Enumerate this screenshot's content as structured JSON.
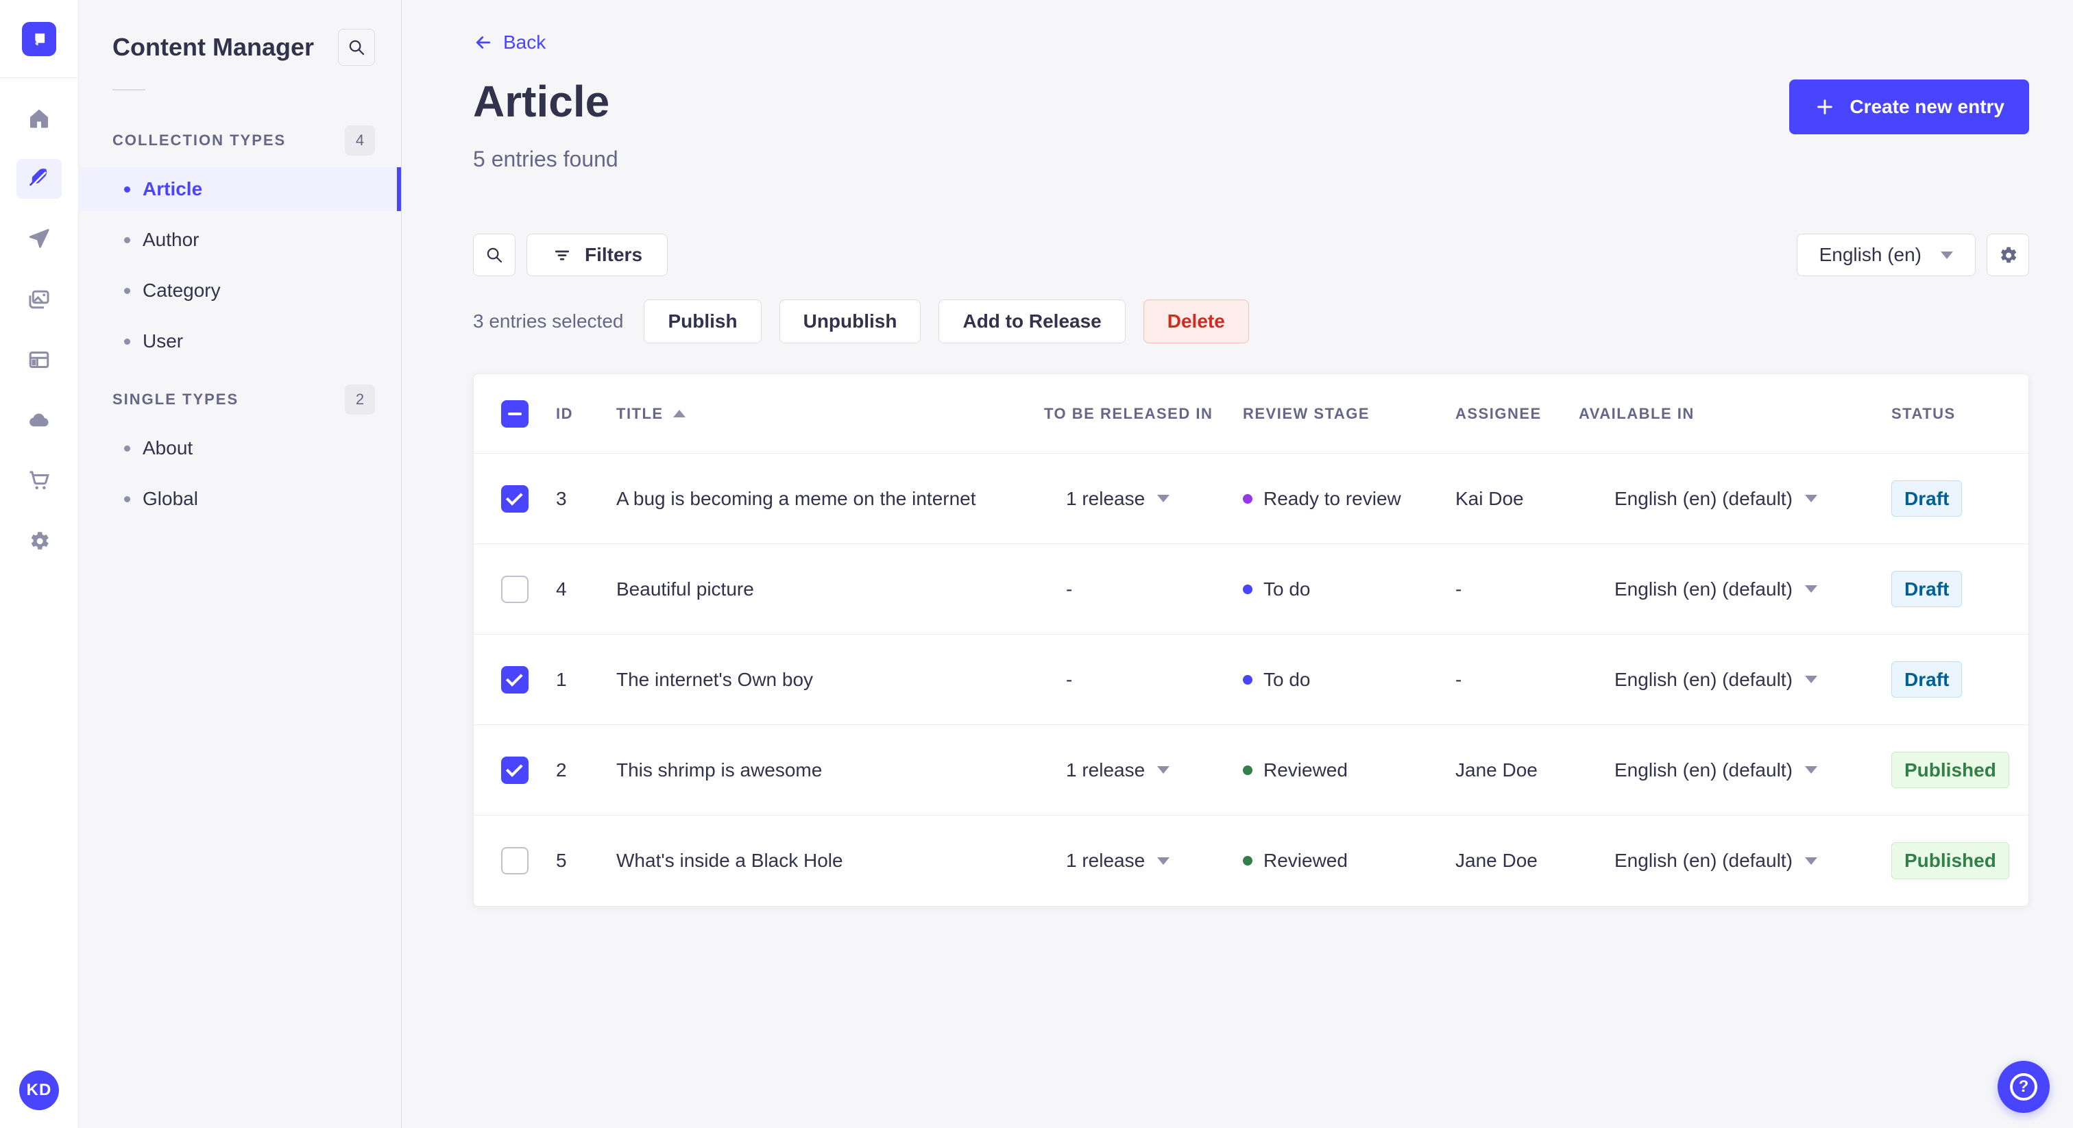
{
  "rail": {
    "icons": [
      "home",
      "content-manager",
      "releases",
      "media-library",
      "content-type-builder",
      "deploy-cloud",
      "marketplace",
      "settings"
    ],
    "active_icon": "content-manager",
    "avatar_initials": "KD"
  },
  "sidebar": {
    "title": "Content Manager",
    "sections": [
      {
        "label": "COLLECTION TYPES",
        "count": "4",
        "items": [
          {
            "label": "Article",
            "active": true
          },
          {
            "label": "Author"
          },
          {
            "label": "Category"
          },
          {
            "label": "User"
          }
        ]
      },
      {
        "label": "SINGLE TYPES",
        "count": "2",
        "items": [
          {
            "label": "About"
          },
          {
            "label": "Global"
          }
        ]
      }
    ]
  },
  "header": {
    "back": "Back",
    "title": "Article",
    "subtitle": "5 entries found",
    "create_button": "Create new entry"
  },
  "toolbar": {
    "filters": "Filters",
    "locale": "English (en)"
  },
  "selection": {
    "label": "3 entries selected",
    "publish": "Publish",
    "unpublish": "Unpublish",
    "add_to_release": "Add to Release",
    "delete": "Delete"
  },
  "table": {
    "columns": [
      "ID",
      "TITLE",
      "TO BE RELEASED IN",
      "REVIEW STAGE",
      "ASSIGNEE",
      "AVAILABLE IN",
      "STATUS"
    ],
    "sort": {
      "column": "TITLE",
      "direction": "ascending"
    },
    "header_checkbox": "indeterminate",
    "rows": [
      {
        "selected": true,
        "id": "3",
        "title": "A bug is becoming a meme on the internet",
        "release": "1 release",
        "release_dropdown": true,
        "stage": "Ready to review",
        "stage_color": "#9736E8",
        "assignee": "Kai Doe",
        "locale": "English (en) (default)",
        "status": "Draft",
        "status_kind": "draft"
      },
      {
        "selected": false,
        "id": "4",
        "title": "Beautiful picture",
        "release": "-",
        "release_dropdown": false,
        "stage": "To do",
        "stage_color": "#4945FF",
        "assignee": "-",
        "locale": "English (en) (default)",
        "status": "Draft",
        "status_kind": "draft"
      },
      {
        "selected": true,
        "id": "1",
        "title": "The internet's Own boy",
        "release": "-",
        "release_dropdown": false,
        "stage": "To do",
        "stage_color": "#4945FF",
        "assignee": "-",
        "locale": "English (en) (default)",
        "status": "Draft",
        "status_kind": "draft"
      },
      {
        "selected": true,
        "id": "2",
        "title": "This shrimp is awesome",
        "release": "1 release",
        "release_dropdown": true,
        "stage": "Reviewed",
        "stage_color": "#328048",
        "assignee": "Jane Doe",
        "locale": "English (en) (default)",
        "status": "Published",
        "status_kind": "published"
      },
      {
        "selected": false,
        "id": "5",
        "title": "What's inside a Black Hole",
        "release": "1 release",
        "release_dropdown": true,
        "stage": "Reviewed",
        "stage_color": "#328048",
        "assignee": "Jane Doe",
        "locale": "English (en) (default)",
        "status": "Published",
        "status_kind": "published"
      }
    ]
  },
  "help": {
    "glyph": "?"
  },
  "colors": {
    "primary": "#4945FF",
    "active_bg": "#F0F0FF",
    "text": "#32324D",
    "text_secondary": "#666687",
    "border": "#DCDCE4",
    "divider": "#EAEAEF",
    "page_bg": "#F6F6F9",
    "draft_text": "#006096",
    "draft_bg": "#EAF5FF",
    "draft_border": "#B8E1FF",
    "published_text": "#328048",
    "published_bg": "#EAFBE7",
    "published_border": "#C6F0C2",
    "danger_text": "#D02B20",
    "danger_bg": "#FCECEA",
    "danger_border": "#F5C0B8",
    "stage_ready_to_review": "#9736E8",
    "stage_to_do": "#4945FF",
    "stage_reviewed": "#328048"
  }
}
